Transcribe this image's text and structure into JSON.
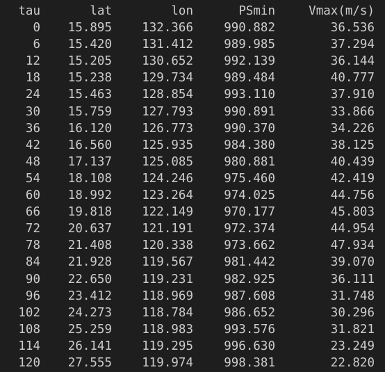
{
  "table": {
    "headers": [
      "tau",
      "lat",
      "lon",
      "PSmin",
      "Vmax(m/s)"
    ],
    "rows": [
      [
        "0",
        "15.895",
        "132.366",
        "990.882",
        "36.536"
      ],
      [
        "6",
        "15.420",
        "131.412",
        "989.985",
        "37.294"
      ],
      [
        "12",
        "15.205",
        "130.652",
        "992.139",
        "36.144"
      ],
      [
        "18",
        "15.238",
        "129.734",
        "989.484",
        "40.777"
      ],
      [
        "24",
        "15.463",
        "128.854",
        "993.110",
        "37.910"
      ],
      [
        "30",
        "15.759",
        "127.793",
        "990.891",
        "33.866"
      ],
      [
        "36",
        "16.120",
        "126.773",
        "990.370",
        "34.226"
      ],
      [
        "42",
        "16.560",
        "125.935",
        "984.380",
        "38.125"
      ],
      [
        "48",
        "17.137",
        "125.085",
        "980.881",
        "40.439"
      ],
      [
        "54",
        "18.108",
        "124.246",
        "975.460",
        "42.419"
      ],
      [
        "60",
        "18.992",
        "123.264",
        "974.025",
        "44.756"
      ],
      [
        "66",
        "19.818",
        "122.149",
        "970.177",
        "45.803"
      ],
      [
        "72",
        "20.637",
        "121.191",
        "972.374",
        "44.954"
      ],
      [
        "78",
        "21.408",
        "120.338",
        "973.662",
        "47.934"
      ],
      [
        "84",
        "21.928",
        "119.567",
        "981.442",
        "39.070"
      ],
      [
        "90",
        "22.650",
        "119.231",
        "982.925",
        "36.111"
      ],
      [
        "96",
        "23.412",
        "118.969",
        "987.608",
        "31.748"
      ],
      [
        "102",
        "24.273",
        "118.784",
        "986.652",
        "30.296"
      ],
      [
        "108",
        "25.259",
        "118.983",
        "993.576",
        "31.821"
      ],
      [
        "114",
        "26.141",
        "119.295",
        "996.630",
        "23.249"
      ],
      [
        "120",
        "27.555",
        "119.974",
        "998.381",
        "22.820"
      ]
    ]
  }
}
